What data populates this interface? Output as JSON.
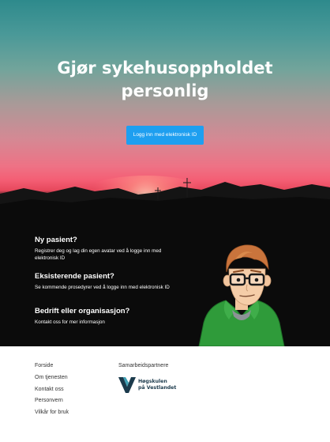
{
  "hero": {
    "title_line1": "Gjør sykehusoppholdet",
    "title_line2": "personlig",
    "login_button_label": "Logg inn med elektronisk ID"
  },
  "sections": [
    {
      "heading": "Ny pasient?",
      "text": "Registrer deg og lag din egen avatar ved å logge inn med elektronisk ID"
    },
    {
      "heading": "Eksisterende pasient?",
      "text": "Se kommende prosedyrer ved å logge inn med elektronisk ID"
    },
    {
      "heading": "Bedrift eller organisasjon?",
      "text": "Kontakt oss for mer informasjon"
    }
  ],
  "footer": {
    "links": [
      "Forside",
      "Om tjenesten",
      "Kontakt oss",
      "Personvern",
      "Vilkår for bruk"
    ],
    "partners_title": "Samarbeidspartnere",
    "partner_logo_line1": "Høgskulen",
    "partner_logo_line2": "på Vestlandet"
  },
  "colors": {
    "accent_button": "#1e9ff0",
    "partner_logo": "#1b3a4c",
    "avatar_hoodie": "#2f9b3a"
  },
  "icons": [
    "hvl-logo-icon",
    "avatar-illustration"
  ]
}
